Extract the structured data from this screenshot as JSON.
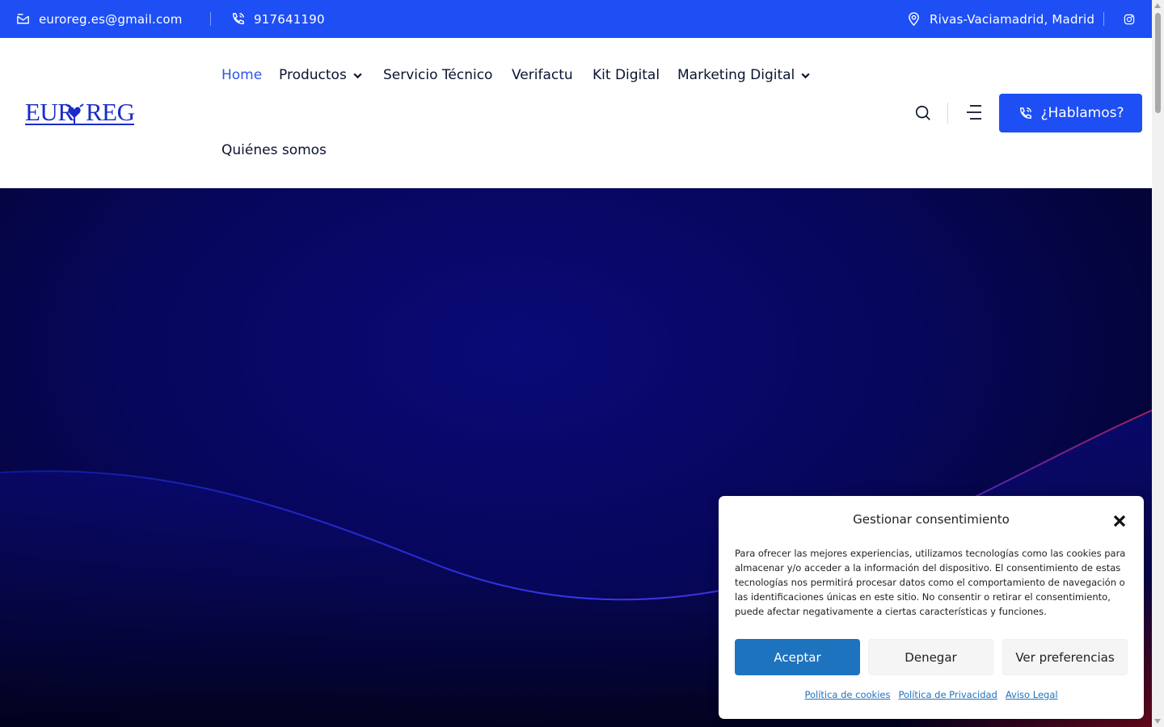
{
  "topbar": {
    "email": "euroreg.es@gmail.com",
    "phone": "917641190",
    "location": "Rivas-Vaciamadrid, Madrid",
    "icons": [
      "mail-icon",
      "phone-icon",
      "location-pin-icon",
      "instagram-icon"
    ]
  },
  "header": {
    "logo_text": "EUROREG",
    "nav": {
      "home": "Home",
      "productos": "Productos",
      "servicio": "Servicio Técnico",
      "verifactu": "Verifactu",
      "kit": "Kit Digital",
      "marketing": "Marketing Digital",
      "quienes": "Quiénes somos"
    },
    "cta_label": "¿Hablamos?"
  },
  "consent": {
    "title": "Gestionar consentimiento",
    "body": "Para ofrecer las mejores experiencias, utilizamos tecnologías como las cookies para almacenar y/o acceder a la información del dispositivo. El consentimiento de estas tecnologías nos permitirá procesar datos como el comportamiento de navegación o las identificaciones únicas en este sitio. No consentir o retirar el consentimiento, puede afectar negativamente a ciertas características y funciones.",
    "accept": "Aceptar",
    "deny": "Denegar",
    "preferences": "Ver preferencias",
    "links": [
      "Política de cookies",
      "Política de Privacidad",
      "Aviso Legal"
    ]
  },
  "colors": {
    "brand_blue": "#1e4ff5",
    "accept_blue": "#1e73be",
    "nav_text": "#0c1330",
    "hero_dark": "#040438"
  }
}
